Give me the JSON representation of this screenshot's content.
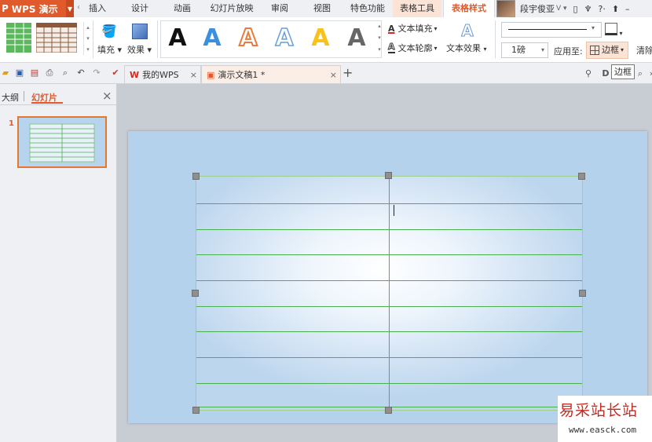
{
  "app": {
    "logo": "P",
    "name": "WPS 演示"
  },
  "menu": {
    "tabs": [
      "插入",
      "设计",
      "动画",
      "幻灯片放映",
      "审阅",
      "视图",
      "特色功能"
    ],
    "tool_tab": "表格工具",
    "active_tab": "表格样式"
  },
  "user": {
    "name": "段宇俊亚"
  },
  "ribbon": {
    "fill_label": "填充",
    "effect_label": "效果",
    "wordart_glyph": "A",
    "text_fill": "文本填充",
    "text_outline": "文本轮廓",
    "text_effect": "文本效果",
    "line_weight": "1磅",
    "apply_to": "应用至:",
    "border": "边框",
    "clear": "清除"
  },
  "doctabs": {
    "mywps": "我的WPS",
    "doc": "演示文稿1 *"
  },
  "panel": {
    "outline_tab": "大纲",
    "slides_tab": "幻灯片",
    "slide_number": "1"
  },
  "tooltip": "边框",
  "watermark": {
    "text": "易采站长站",
    "url": "www.easck.com"
  },
  "colors": {
    "accent": "#e05a2b",
    "table_line": "#4caf50",
    "slide_bg": "#b5d2ec"
  }
}
